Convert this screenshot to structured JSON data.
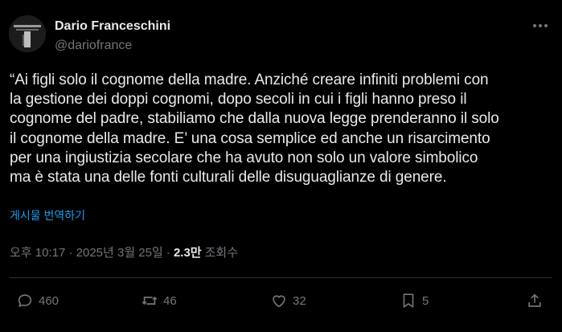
{
  "author": {
    "name": "Dario Franceschini",
    "handle": "@dariofrance"
  },
  "tweet": {
    "text": "“Ai figli solo il cognome della madre. Anziché creare infiniti problemi con\nla gestione dei doppi cognomi, dopo secoli in cui i figli hanno preso il\ncognome del padre, stabiliamo che dalla nuova legge prenderanno il solo\nil cognome della madre. E’ una cosa semplice ed anche un risarcimento\nper una ingiustizia secolare che ha avuto non solo un valore simbolico\nma è stata una delle fonti culturali delle disuguaglianze di genere.",
    "translate_label": "게시물 번역하기"
  },
  "meta": {
    "timestamp": "오후 10:17 · 2025년 3월 25일 ·",
    "views_count": "2.3만",
    "views_label": "조회수"
  },
  "actions": {
    "replies": "460",
    "reposts": "46",
    "likes": "32",
    "bookmarks": "5"
  },
  "colors": {
    "background": "#000000",
    "text": "#e7e9ea",
    "secondary": "#71767b",
    "link": "#1d9bf0",
    "divider": "#2f3336"
  }
}
